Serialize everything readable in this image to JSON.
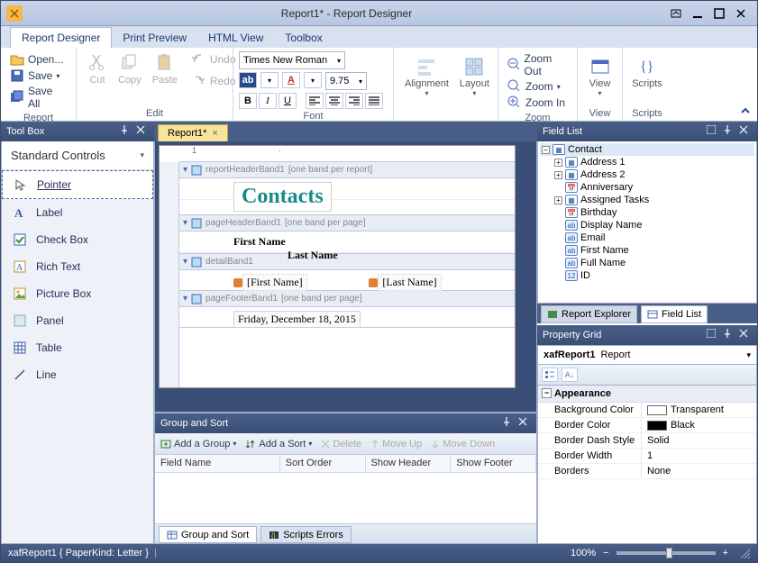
{
  "window": {
    "title": "Report1* - Report Designer"
  },
  "menu_tabs": [
    "Report Designer",
    "Print Preview",
    "HTML View",
    "Toolbox"
  ],
  "menu_selected": 0,
  "ribbon": {
    "report": {
      "label": "Report",
      "open": "Open...",
      "save": "Save",
      "save_all": "Save All"
    },
    "edit": {
      "label": "Edit",
      "cut": "Cut",
      "copy": "Copy",
      "paste": "Paste",
      "undo": "Undo",
      "redo": "Redo"
    },
    "font": {
      "label": "Font",
      "family": "Times New Roman",
      "size": "9.75"
    },
    "alignment": {
      "label": "Alignment",
      "btn": "Alignment"
    },
    "layout": {
      "label": "Layout",
      "btn": "Layout"
    },
    "zoom": {
      "label": "Zoom",
      "out": "Zoom Out",
      "zoom": "Zoom",
      "in": "Zoom In"
    },
    "view": {
      "label": "View",
      "btn": "View"
    },
    "scripts": {
      "label": "Scripts",
      "btn": "Scripts"
    }
  },
  "toolbox": {
    "title": "Tool Box",
    "section": "Standard Controls",
    "items": [
      {
        "name": "Pointer",
        "icon": "pointer"
      },
      {
        "name": "Label",
        "icon": "label"
      },
      {
        "name": "Check Box",
        "icon": "checkbox"
      },
      {
        "name": "Rich Text",
        "icon": "richtext"
      },
      {
        "name": "Picture Box",
        "icon": "picture"
      },
      {
        "name": "Panel",
        "icon": "panel"
      },
      {
        "name": "Table",
        "icon": "table"
      },
      {
        "name": "Line",
        "icon": "line"
      }
    ]
  },
  "designer": {
    "tab": "Report1*",
    "bands": [
      {
        "name": "reportHeaderBand1",
        "hint": "[one band per report]"
      },
      {
        "name": "pageHeaderBand1",
        "hint": "[one band per page]"
      },
      {
        "name": "detailBand1",
        "hint": ""
      },
      {
        "name": "pageFooterBand1",
        "hint": "[one band per page]"
      }
    ],
    "title_text": "Contacts",
    "col1": "First Name",
    "col2": "Last Name",
    "bind1": "[First Name]",
    "bind2": "[Last Name]",
    "date": "Friday, December 18, 2015"
  },
  "group_sort": {
    "title": "Group and Sort",
    "add_group": "Add a Group",
    "add_sort": "Add a Sort",
    "delete": "Delete",
    "move_up": "Move Up",
    "move_down": "Move Down",
    "cols": [
      "Field Name",
      "Sort Order",
      "Show Header",
      "Show Footer"
    ],
    "tab1": "Group and Sort",
    "tab2": "Scripts Errors"
  },
  "field_list": {
    "title": "Field List",
    "root": "Contact",
    "items": [
      {
        "name": "Address 1",
        "kind": "table",
        "expandable": true
      },
      {
        "name": "Address 2",
        "kind": "table",
        "expandable": true
      },
      {
        "name": "Anniversary",
        "kind": "date",
        "expandable": false
      },
      {
        "name": "Assigned Tasks",
        "kind": "table",
        "expandable": true
      },
      {
        "name": "Birthday",
        "kind": "date",
        "expandable": false
      },
      {
        "name": "Display Name",
        "kind": "text",
        "expandable": false
      },
      {
        "name": "Email",
        "kind": "text",
        "expandable": false
      },
      {
        "name": "First Name",
        "kind": "text",
        "expandable": false
      },
      {
        "name": "Full Name",
        "kind": "text",
        "expandable": false
      },
      {
        "name": "ID",
        "kind": "num",
        "expandable": false
      }
    ],
    "tab_explorer": "Report Explorer",
    "tab_fieldlist": "Field List"
  },
  "property_grid": {
    "title": "Property Grid",
    "object": "xafReport1",
    "type": "Report",
    "category": "Appearance",
    "rows": [
      {
        "k": "Background Color",
        "v": "Transparent",
        "color": "#ffffff"
      },
      {
        "k": "Border Color",
        "v": "Black",
        "color": "#000000"
      },
      {
        "k": "Border Dash Style",
        "v": "Solid"
      },
      {
        "k": "Border Width",
        "v": "1"
      },
      {
        "k": "Borders",
        "v": "None"
      }
    ]
  },
  "status": {
    "left": "xafReport1 { PaperKind: Letter }",
    "zoom": "100%"
  }
}
